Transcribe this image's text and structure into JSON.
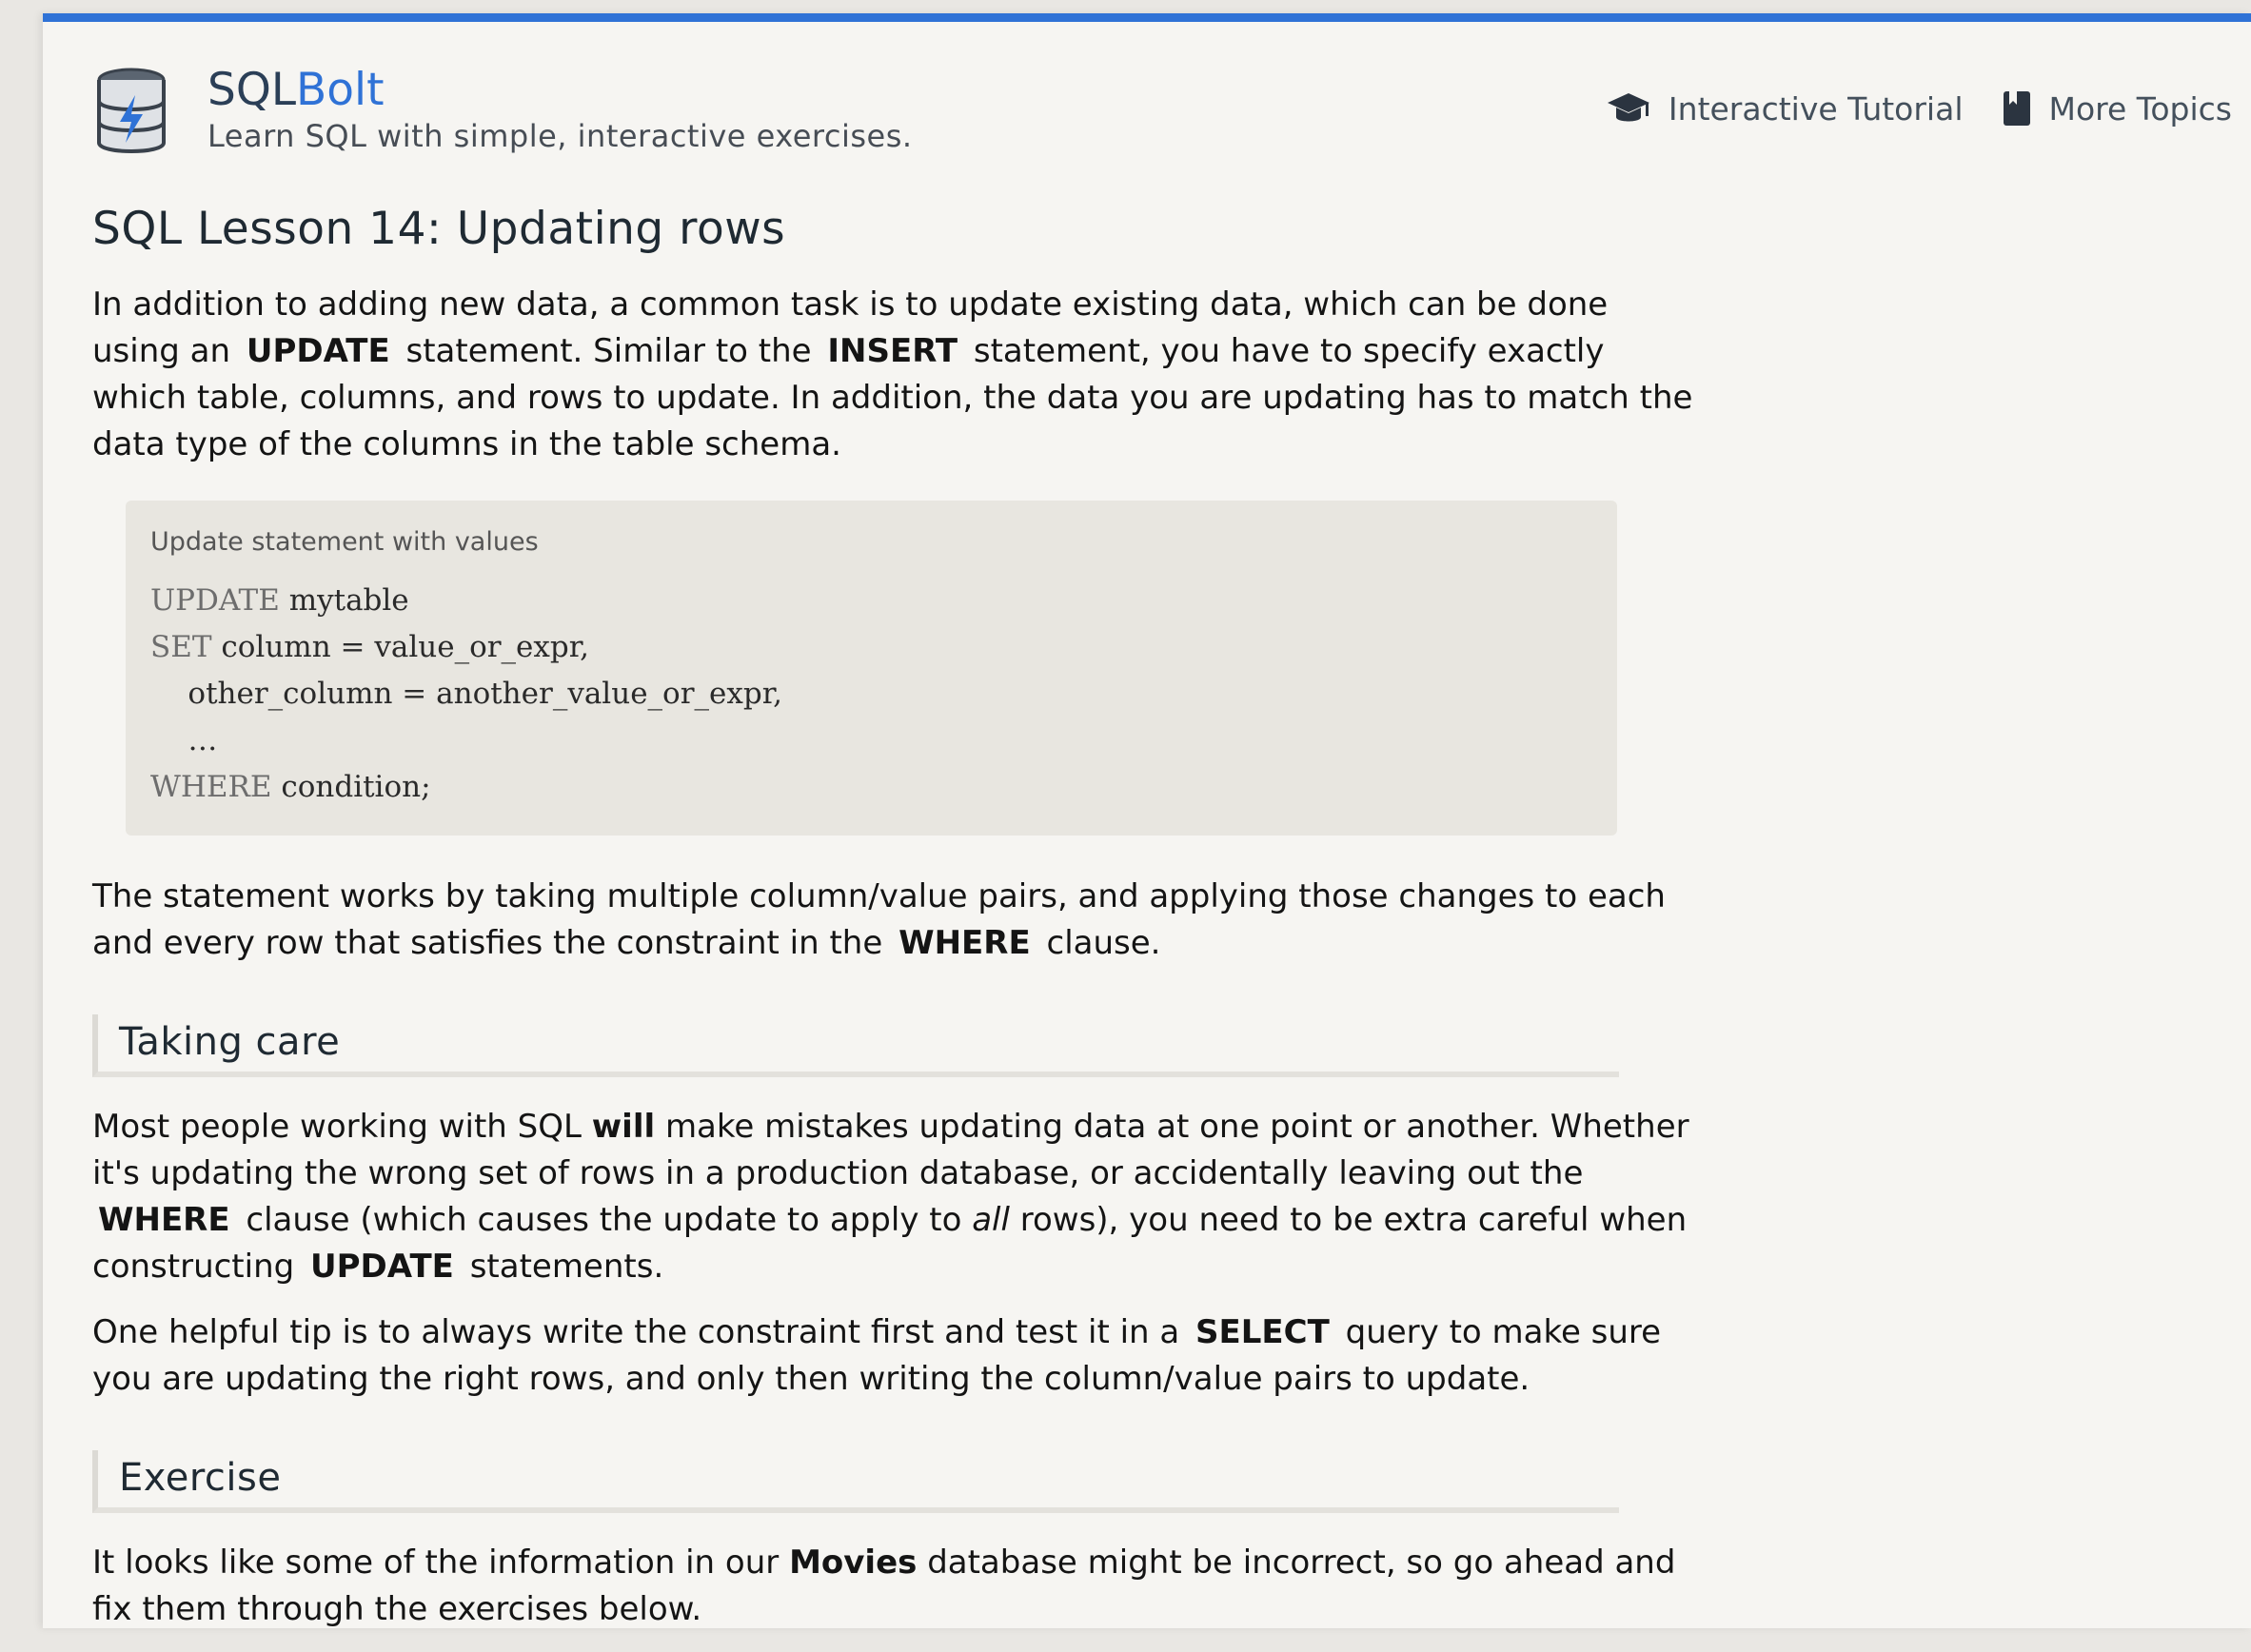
{
  "header": {
    "brand_sql": "SQL",
    "brand_bolt": "Bolt",
    "tagline": "Learn SQL with simple, interactive exercises.",
    "nav": [
      {
        "label": "Interactive Tutorial",
        "icon": "graduation-cap-icon"
      },
      {
        "label": "More Topics",
        "icon": "book-icon"
      }
    ]
  },
  "lesson": {
    "title": "SQL Lesson 14: Updating rows",
    "intro": {
      "t1": "In addition to adding new data, a common task is to update existing data, which can be done using an",
      "kw1": "UPDATE",
      "t2": "statement. Similar to the",
      "kw2": "INSERT",
      "t3": "statement, you have to specify exactly which table, columns, and rows to update. In addition, the data you are updating has to match the data type of the columns in the table schema."
    },
    "code": {
      "title": "Update statement with values",
      "lines": [
        {
          "kw": "UPDATE",
          "rest": " mytable"
        },
        {
          "kw": "SET",
          "rest": " column = value_or_expr,"
        },
        {
          "kw": "",
          "rest": "    other_column = another_value_or_expr,"
        },
        {
          "kw": "",
          "rest": "    …"
        },
        {
          "kw": "WHERE",
          "rest": " condition;"
        }
      ]
    },
    "para2": {
      "t1": "The statement works by taking multiple column/value pairs, and applying those changes to each and every row that satisfies the constraint in the",
      "kw1": "WHERE",
      "t2": "clause."
    },
    "section1": {
      "title": "Taking care",
      "p1": {
        "t1": "Most people working with SQL",
        "b1": "will",
        "t2": "make mistakes updating data at one point or another. Whether it's updating the wrong set of rows in a production database, or accidentally leaving out the",
        "kw1": "WHERE",
        "t3": "clause (which causes the update to apply to",
        "i1": "all",
        "t4": "rows), you need to be extra careful when constructing",
        "kw2": "UPDATE",
        "t5": "statements."
      },
      "p2": {
        "t1": "One helpful tip is to always write the constraint first and test it in a",
        "kw1": "SELECT",
        "t2": "query to make sure you are updating the right rows, and only then writing the column/value pairs to update."
      }
    },
    "section2": {
      "title": "Exercise",
      "p1": {
        "t1": "It looks like some of the information in our",
        "b1": "Movies",
        "t2": "database might be incorrect, so go ahead and fix them through the exercises below."
      }
    }
  },
  "colors": {
    "accent": "#2f72d6",
    "page": "#f6f5f2",
    "code_bg": "#e8e6e0"
  }
}
